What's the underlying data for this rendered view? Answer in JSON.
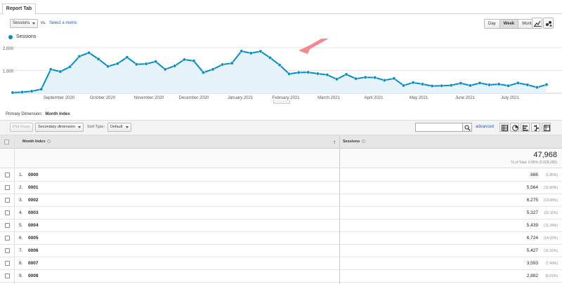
{
  "tab": {
    "label": "Report Tab"
  },
  "metric": {
    "selected": "Sessions",
    "vs_label": "vs.",
    "select_metric": "Select a metric"
  },
  "range": {
    "day": "Day",
    "week": "Week",
    "month": "Month",
    "active": "Week"
  },
  "legend": {
    "series_name": "Sessions"
  },
  "colors": {
    "line": "#058dc7",
    "area": "#e6f3fa",
    "arrow": "#f4898f",
    "link": "#1a64b8"
  },
  "chart_data": {
    "type": "area",
    "series": [
      {
        "name": "Sessions",
        "values": [
          30,
          50,
          90,
          180,
          1050,
          950,
          1160,
          1620,
          1780,
          1500,
          1180,
          1300,
          1580,
          1270,
          1290,
          1390,
          1050,
          1200,
          1480,
          1420,
          910,
          1050,
          1260,
          1320,
          1850,
          1760,
          1840,
          1560,
          1240,
          850,
          910,
          920,
          860,
          810,
          620,
          830,
          640,
          700,
          690,
          570,
          650,
          340,
          470,
          400,
          320,
          330,
          350,
          440,
          340,
          450,
          370,
          400,
          330,
          450,
          370,
          260,
          380
        ]
      }
    ],
    "x_ticks": [
      "September 2020",
      "October 2020",
      "November 2020",
      "December 2020",
      "January 2021",
      "February 2021",
      "March 2021",
      "April 2021",
      "May 2021",
      "June 2021",
      "July 2021"
    ],
    "y_ticks": [
      "2,000",
      "1,000"
    ],
    "ylim": [
      0,
      2000
    ]
  },
  "primary_dimension": {
    "label": "Primary Dimension:",
    "value": "Month Index"
  },
  "toolbar": {
    "plot_rows": "Plot Rows",
    "secondary_dimension": "Secondary dimension",
    "sort_type_label": "Sort Type:",
    "sort_type_value": "Default",
    "advanced": "advanced"
  },
  "table": {
    "col_dim": "Month Index",
    "col_metric": "Sessions",
    "total": "47,968",
    "total_pct": "% of Total: 0.95% (5,028,286)",
    "rows": [
      {
        "idx": "1.",
        "dim": "0000",
        "val": "886",
        "pct": "(1.85%)"
      },
      {
        "idx": "2.",
        "dim": "0001",
        "val": "5,564",
        "pct": "(11.60%)"
      },
      {
        "idx": "3.",
        "dim": "0002",
        "val": "6,275",
        "pct": "(13.08%)"
      },
      {
        "idx": "4.",
        "dim": "0003",
        "val": "5,327",
        "pct": "(11.11%)"
      },
      {
        "idx": "5.",
        "dim": "0004",
        "val": "5,439",
        "pct": "(11.34%)"
      },
      {
        "idx": "6.",
        "dim": "0005",
        "val": "6,724",
        "pct": "(14.02%)"
      },
      {
        "idx": "7.",
        "dim": "0006",
        "val": "5,427",
        "pct": "(11.31%)"
      },
      {
        "idx": "8.",
        "dim": "0007",
        "val": "3,593",
        "pct": "(7.49%)"
      },
      {
        "idx": "9.",
        "dim": "0008",
        "val": "2,882",
        "pct": "(6.01%)"
      }
    ]
  }
}
